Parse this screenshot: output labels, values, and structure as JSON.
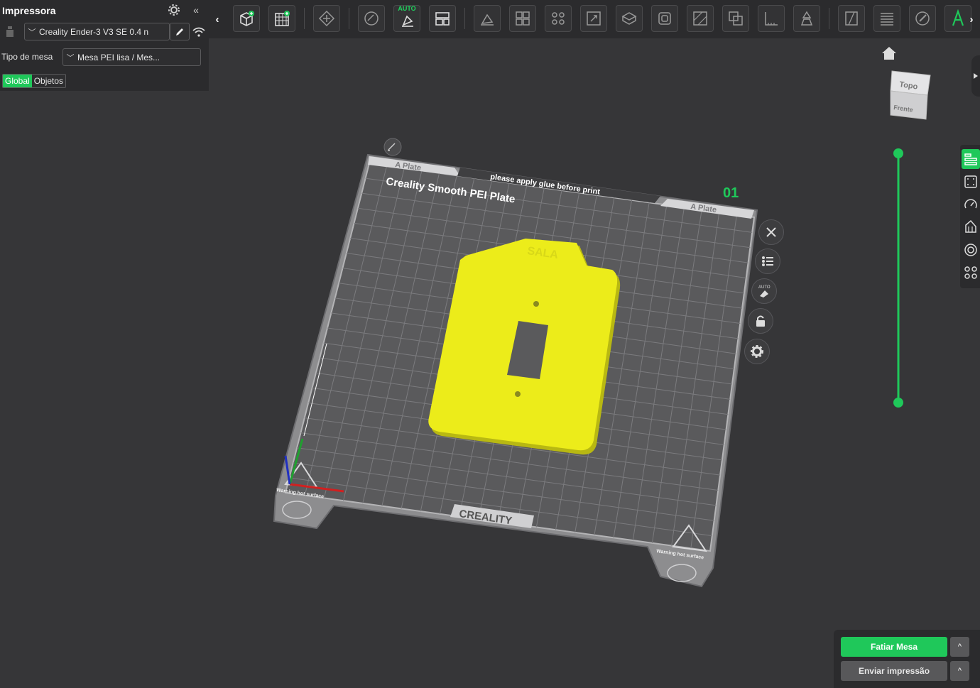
{
  "toolbar": {
    "auto_label": "AUTO",
    "tools": [
      {
        "name": "add-object-icon"
      },
      {
        "name": "add-plate-icon"
      },
      {
        "name": "auto-orient-icon"
      },
      {
        "name": "arrange-icon"
      },
      {
        "name": "auto-arrange-icon"
      },
      {
        "name": "layout-icon"
      },
      {
        "name": "lay-on-face-icon"
      },
      {
        "name": "split-objects-icon"
      },
      {
        "name": "split-parts-icon"
      },
      {
        "name": "scale-icon"
      },
      {
        "name": "cut-icon"
      },
      {
        "name": "hollow-icon"
      },
      {
        "name": "paint-support-icon"
      },
      {
        "name": "boolean-icon"
      },
      {
        "name": "measure-icon"
      },
      {
        "name": "emboss-icon"
      },
      {
        "name": "seam-icon"
      },
      {
        "name": "layer-icon"
      },
      {
        "name": "color-paint-icon"
      },
      {
        "name": "text-icon"
      }
    ],
    "prev_symbol": "‹",
    "next_symbol": "›"
  },
  "left_panel": {
    "title": "Impressora",
    "printer": "Creality Ender-3 V3 SE 0.4 n",
    "bed_type_label": "Tipo de mesa",
    "bed_type_value": "Mesa PEI lisa / Mes...",
    "tabs": [
      "Global",
      "Objetos"
    ],
    "active_tab": "Global",
    "collapse_symbol": "«"
  },
  "plate": {
    "plate_name_left": "A Plate",
    "plate_name_right": "A Plate",
    "plate_title": "Creality Smooth PEI Plate",
    "glue_note": "please apply glue before print",
    "plate_number": "01",
    "brand": "CREALITY",
    "warning_text": "Warning hot surface",
    "model_label": "SALA"
  },
  "view_cube": {
    "top": "Topo",
    "front": "Frente"
  },
  "bottom": {
    "slice_button": "Fatiar Mesa",
    "send_button": "Enviar impressão",
    "caret": "^"
  },
  "colors": {
    "accent": "#1fc85a",
    "model": "#ecec1a",
    "background": "#363638",
    "panel": "#2b2b2d"
  }
}
